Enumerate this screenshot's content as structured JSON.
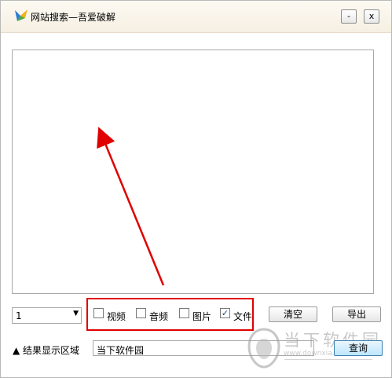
{
  "window": {
    "title": "网站搜索—吾爱破解",
    "minimize_label": "-",
    "close_label": "x"
  },
  "controls": {
    "count_select": {
      "value": "1"
    },
    "filters": [
      {
        "label": "视频",
        "checked": false
      },
      {
        "label": "音频",
        "checked": false
      },
      {
        "label": "图片",
        "checked": false
      },
      {
        "label": "文件",
        "checked": true
      }
    ],
    "clear_label": "清空",
    "export_label": "导出"
  },
  "search": {
    "section_label": "▲ 结果显示区域",
    "query_value": "当下软件园",
    "query_button_label": "查询"
  },
  "watermark": {
    "brand": "当下软件园",
    "url": "www.downxia.com"
  },
  "colors": {
    "annotation": "#e00000",
    "title_bar": "#f8f2e7"
  }
}
